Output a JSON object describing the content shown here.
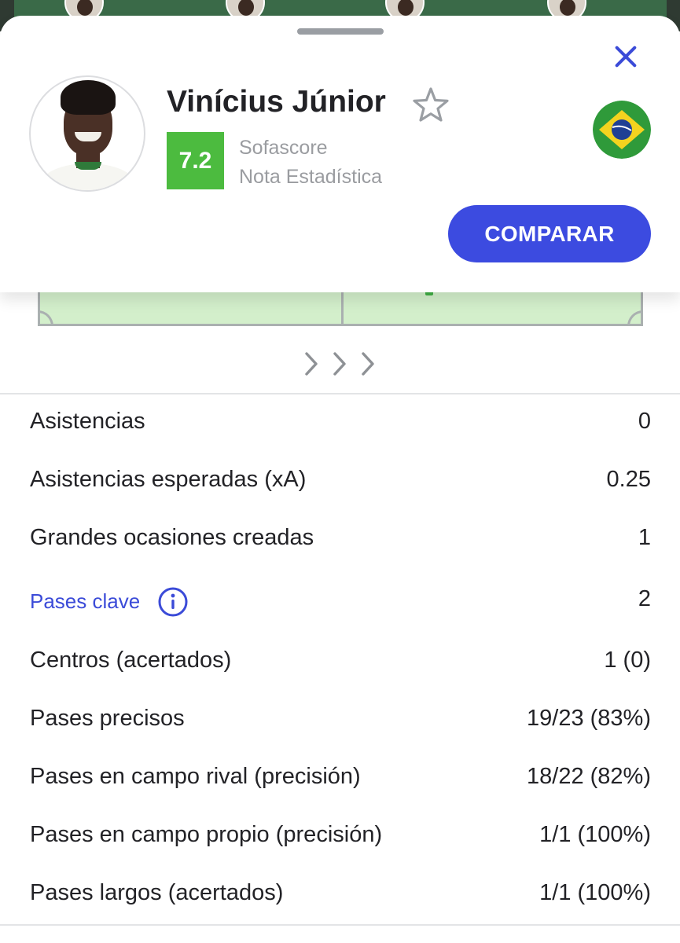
{
  "player": {
    "name": "Vinícius Júnior",
    "rating": "7.2",
    "rating_source_line1": "Sofascore",
    "rating_source_line2": "Nota Estadística",
    "nationality_flag": "brazil-flag-icon"
  },
  "actions": {
    "compare_label": "COMPARAR"
  },
  "colors": {
    "accent": "#3c4be0",
    "rating_green": "#4cbb3f",
    "pitch_green": "#d3efcb"
  },
  "stats": [
    {
      "label": "Asistencias",
      "value": "0"
    },
    {
      "label": "Asistencias esperadas (xA)",
      "value": "0.25"
    },
    {
      "label": "Grandes ocasiones creadas",
      "value": "1"
    },
    {
      "label": "Pases clave",
      "value": "2",
      "link": true
    },
    {
      "label": "Centros (acertados)",
      "value": "1 (0)"
    },
    {
      "label": "Pases precisos",
      "value": "19/23 (83%)"
    },
    {
      "label": "Pases en campo rival (precisión)",
      "value": "18/22 (82%)"
    },
    {
      "label": "Pases en campo propio (precisión)",
      "value": "1/1 (100%)"
    },
    {
      "label": "Pases largos (acertados)",
      "value": "1/1 (100%)"
    }
  ]
}
